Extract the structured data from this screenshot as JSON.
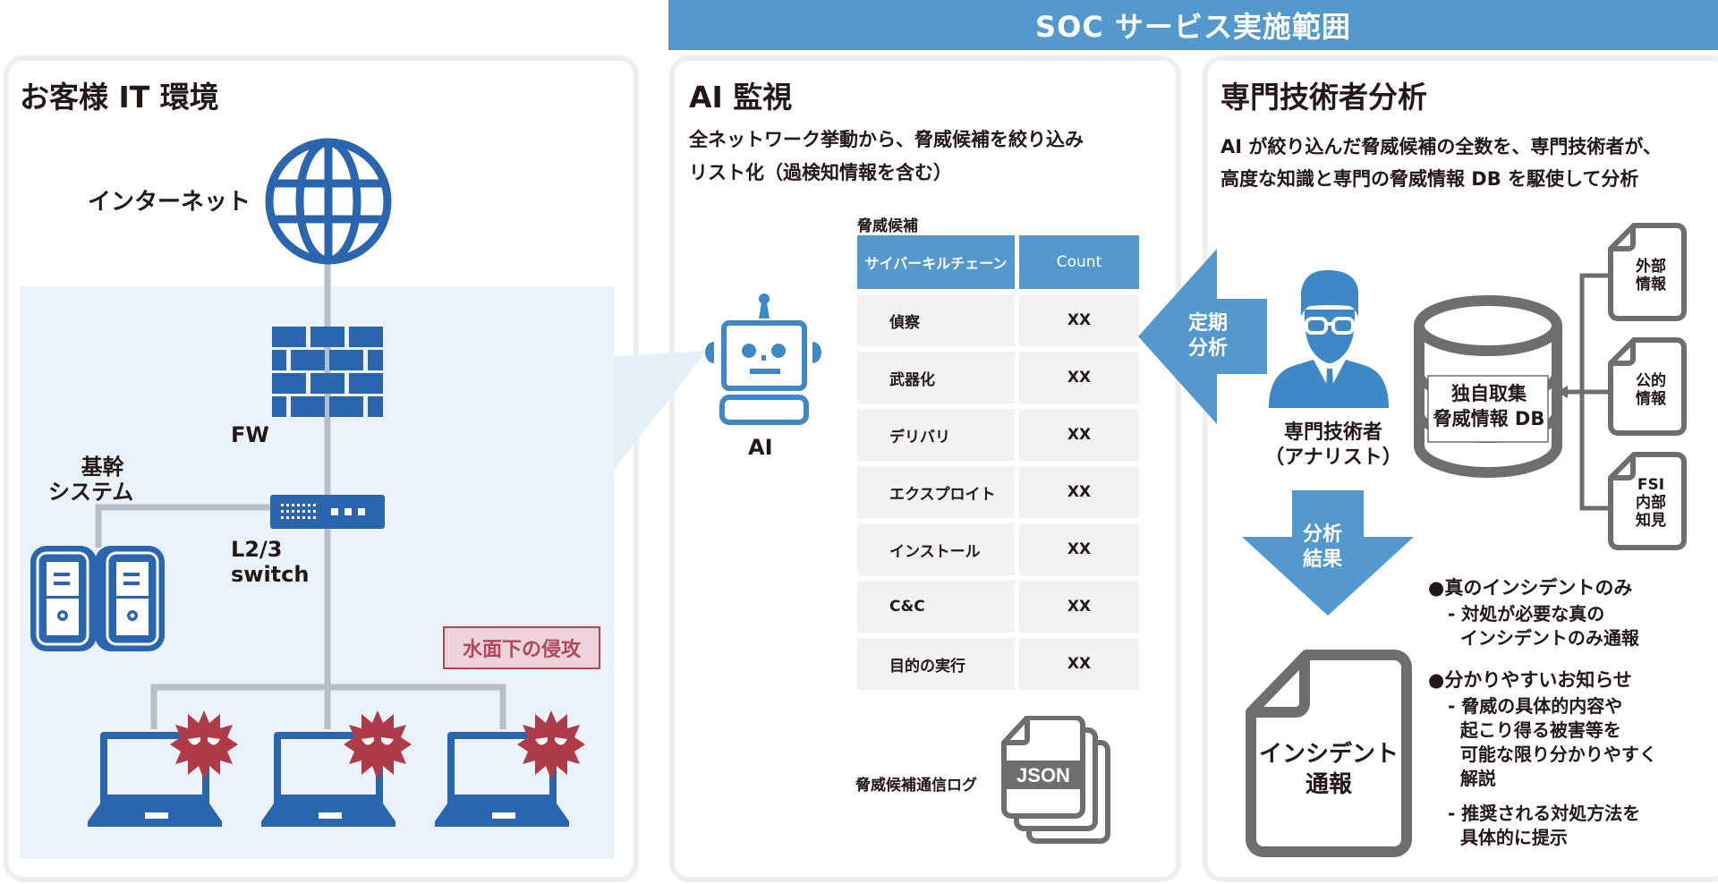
{
  "banner": {
    "title": "SOC サービス実施範囲"
  },
  "customer_panel": {
    "title": "お客様 IT 環境",
    "internet_label": "インターネット",
    "fw_label": "FW",
    "core_system_label_line1": "基幹",
    "core_system_label_line2": "システム",
    "switch_label_line1": "L2/3",
    "switch_label_line2": "switch",
    "attack_note": "水面下の侵攻",
    "endpoint_count": 3
  },
  "ai_panel": {
    "title": "AI 監視",
    "desc_line1": "全ネットワーク挙動から、脅威候補を絞り込み",
    "desc_line2": "リスト化（過検知情報を含む）",
    "ai_label": "AI",
    "table": {
      "title": "脅威候補",
      "headers": [
        "サイバーキルチェーン",
        "Count"
      ],
      "rows": [
        {
          "stage": "偵察",
          "count": "XX"
        },
        {
          "stage": "武器化",
          "count": "XX"
        },
        {
          "stage": "デリバリ",
          "count": "XX"
        },
        {
          "stage": "エクスプロイト",
          "count": "XX"
        },
        {
          "stage": "インストール",
          "count": "XX"
        },
        {
          "stage": "C&C",
          "count": "XX"
        },
        {
          "stage": "目的の実行",
          "count": "XX"
        }
      ]
    },
    "log_label": "脅威候補通信ログ",
    "log_file_label": "JSON"
  },
  "analyst_panel": {
    "title": "専門技術者分析",
    "desc_line1": "AI が絞り込んだ脅威候補の全数を、専門技術者が、",
    "desc_line2": "高度な知識と専門の脅威情報 DB を駆使して分析",
    "periodic_arrow_line1": "定期",
    "periodic_arrow_line2": "分析",
    "analyst_label_line1": "専門技術者",
    "analyst_label_line2": "（アナリスト）",
    "result_arrow_line1": "分析",
    "result_arrow_line2": "結果",
    "db_label_line1": "独自取集",
    "db_label_line2": "脅威情報 DB",
    "sources": [
      {
        "line1": "外部",
        "line2": "情報",
        "line3": ""
      },
      {
        "line1": "公的",
        "line2": "情報",
        "line3": ""
      },
      {
        "line1": "FSI",
        "line2": "内部",
        "line3": "知見"
      }
    ],
    "incident_doc_line1": "インシデント",
    "incident_doc_line2": "通報",
    "bullets": [
      {
        "heading": "●真のインシデントのみ",
        "items": [
          [
            "- 対処が必要な真の",
            "  インシデントのみ通報"
          ]
        ]
      },
      {
        "heading": "●分かりやすいお知らせ",
        "items": [
          [
            "- 脅威の具体的内容や",
            "  起こり得る被害等を",
            "  可能な限り分かりやすく",
            "  解説"
          ],
          [
            "- 推奨される対処方法を",
            "  具体的に提示"
          ]
        ]
      }
    ]
  },
  "colors": {
    "banner": "#5399cf",
    "icon_blue": "#2a66b0",
    "ai_blue": "#3f88c8",
    "arrow_blue": "#5399cf",
    "virus_red": "#b03a48",
    "line_gray": "#b6bec6",
    "doc_gray": "#6e6e6e",
    "water_bg": "#eaf2fb"
  }
}
